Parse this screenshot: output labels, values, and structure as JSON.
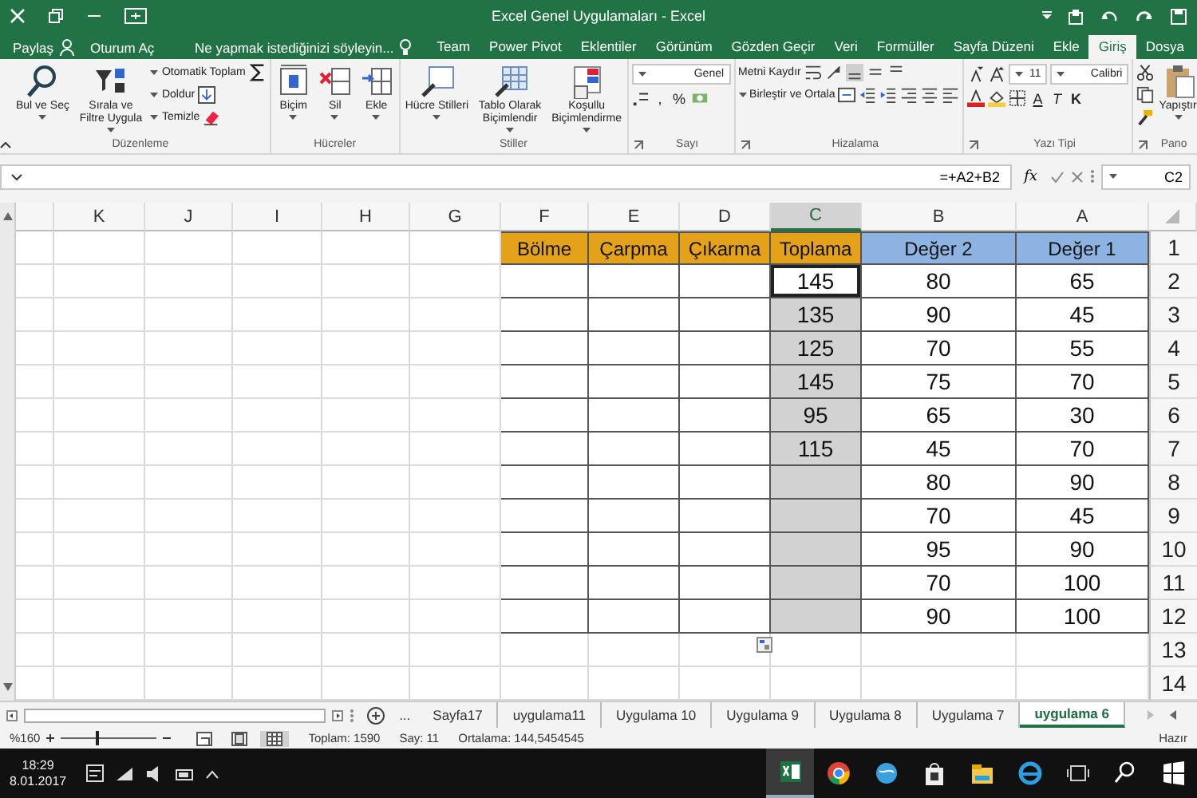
{
  "window": {
    "title": "Excel Genel Uygulamaları - Excel"
  },
  "account": {
    "share": "Paylaş",
    "sign_in": "Oturum Aç"
  },
  "tell_me": {
    "placeholder": "Ne yapmak istediğinizi söyleyin..."
  },
  "ribbon_tabs": [
    {
      "label": "Team",
      "selected": false
    },
    {
      "label": "Power Pivot",
      "selected": false
    },
    {
      "label": "Eklentiler",
      "selected": false
    },
    {
      "label": "Görünüm",
      "selected": false
    },
    {
      "label": "Gözden Geçir",
      "selected": false
    },
    {
      "label": "Veri",
      "selected": false
    },
    {
      "label": "Formüller",
      "selected": false
    },
    {
      "label": "Sayfa Düzeni",
      "selected": false
    },
    {
      "label": "Ekle",
      "selected": false
    },
    {
      "label": "Giriş",
      "selected": true
    },
    {
      "label": "Dosya",
      "selected": false
    }
  ],
  "ribbon_groups": [
    {
      "label": "Düzenleme",
      "launcher": false,
      "items": [
        {
          "kind": "large",
          "label": "Bul ve Seç",
          "menu": true
        },
        {
          "kind": "large",
          "label": "Sırala ve Filtre Uygula",
          "menu": true
        },
        {
          "kind": "stack",
          "lines": [
            {
              "items": [
                {
                  "kind": "small",
                  "label": "Otomatik Toplam",
                  "menu": true
                }
              ]
            },
            {
              "items": [
                {
                  "kind": "small",
                  "label": "Doldur",
                  "menu": true
                }
              ]
            },
            {
              "items": [
                {
                  "kind": "small",
                  "label": "Temizle",
                  "menu": true
                }
              ]
            }
          ]
        }
      ]
    },
    {
      "label": "Hücreler",
      "launcher": false,
      "items": [
        {
          "kind": "large",
          "label": "Biçim",
          "menu": true
        },
        {
          "kind": "large",
          "label": "Sil",
          "menu": true
        },
        {
          "kind": "large",
          "label": "Ekle",
          "menu": true
        }
      ]
    },
    {
      "label": "Stiller",
      "launcher": false,
      "items": [
        {
          "kind": "large",
          "label": "Hücre Stilleri",
          "menu": true
        },
        {
          "kind": "large",
          "label": "Tablo Olarak Biçimlendir",
          "menu": true
        },
        {
          "kind": "large",
          "label": "Koşullu Biçimlendirme",
          "menu": true
        }
      ]
    },
    {
      "label": "Sayı",
      "launcher": true,
      "items": [
        {
          "kind": "stack",
          "lines": [
            {
              "items": [
                {
                  "kind": "combo",
                  "value": "Genel"
                }
              ]
            },
            {
              "items": [
                {
                  "kind": "icon"
                },
                {
                  "kind": "glyph",
                  "text": ","
                },
                {
                  "kind": "glyph",
                  "text": "%"
                },
                {
                  "kind": "icon"
                }
              ]
            }
          ]
        }
      ]
    },
    {
      "label": "Hizalama",
      "launcher": true,
      "items": [
        {
          "kind": "stack",
          "lines": [
            {
              "items": [
                {
                  "kind": "small",
                  "label": "Metni Kaydır",
                  "menu": false
                },
                {
                  "kind": "icon"
                },
                {
                  "kind": "icon"
                },
                {
                  "kind": "icon"
                },
                {
                  "kind": "icon"
                }
              ]
            },
            {
              "items": [
                {
                  "kind": "small",
                  "label": "Birleştir ve Ortala",
                  "menu": true
                },
                {
                  "kind": "icon"
                },
                {
                  "kind": "icon"
                },
                {
                  "kind": "icon"
                },
                {
                  "kind": "icon"
                },
                {
                  "kind": "icon"
                }
              ]
            }
          ]
        }
      ]
    },
    {
      "label": "Yazı Tipi",
      "launcher": true,
      "items": [
        {
          "kind": "stack",
          "lines": [
            {
              "items": [
                {
                  "kind": "icon"
                },
                {
                  "kind": "icon"
                },
                {
                  "kind": "combo",
                  "value": "11"
                },
                {
                  "kind": "combo",
                  "value": "Calibri"
                }
              ]
            },
            {
              "items": [
                {
                  "kind": "icon"
                },
                {
                  "kind": "icon"
                },
                {
                  "kind": "icon"
                },
                {
                  "kind": "glyph",
                  "text": "A"
                },
                {
                  "kind": "glyph",
                  "text": "T"
                },
                {
                  "kind": "glyph",
                  "text": "K"
                }
              ]
            }
          ]
        }
      ]
    },
    {
      "label": "Pano",
      "launcher": true,
      "items": [
        {
          "kind": "stack",
          "lines": [
            {
              "items": [
                {
                  "kind": "icon"
                }
              ]
            },
            {
              "items": [
                {
                  "kind": "icon"
                }
              ]
            },
            {
              "items": [
                {
                  "kind": "icon"
                }
              ]
            }
          ]
        },
        {
          "kind": "large",
          "label": "Yapıştır",
          "menu": true
        }
      ]
    }
  ],
  "formula_bar": {
    "formula": "=+A2+B2",
    "function_label": "fx",
    "name_box": "C2"
  },
  "sheet": {
    "columns": [
      {
        "label": "K",
        "selected": false
      },
      {
        "label": "J",
        "selected": false
      },
      {
        "label": "I",
        "selected": false
      },
      {
        "label": "H",
        "selected": false
      },
      {
        "label": "G",
        "selected": false
      },
      {
        "label": "F",
        "selected": false
      },
      {
        "label": "E",
        "selected": false
      },
      {
        "label": "D",
        "selected": false
      },
      {
        "label": "C",
        "selected": true
      },
      {
        "label": "B",
        "selected": false
      },
      {
        "label": "A",
        "selected": false
      }
    ],
    "rows": [
      {
        "cells": [
          {
            "text": "Bölme",
            "color": "#e3a21a"
          },
          {
            "text": "Çarpma",
            "color": "#e3a21a"
          },
          {
            "text": "Çıkarma",
            "color": "#e3a21a"
          },
          {
            "text": "Toplama",
            "color": "#e3a21a"
          },
          {
            "text": "Değer 2",
            "color": "#8db3e2"
          },
          {
            "text": "Değer 1",
            "color": "#8db3e2"
          }
        ],
        "number": "1"
      },
      {
        "cells": [
          {
            "selected": false,
            "active": false
          },
          {
            "selected": false,
            "active": false
          },
          {
            "selected": false,
            "active": false
          },
          {
            "text": "145",
            "selected": false,
            "active": true
          },
          {
            "text": "80",
            "selected": false,
            "active": false
          },
          {
            "text": "65",
            "selected": false,
            "active": false
          }
        ],
        "number": "2"
      },
      {
        "cells": [
          {
            "selected": false,
            "active": false
          },
          {
            "selected": false,
            "active": false
          },
          {
            "selected": false,
            "active": false
          },
          {
            "text": "135",
            "selected": true,
            "active": false
          },
          {
            "text": "90",
            "selected": false,
            "active": false
          },
          {
            "text": "45",
            "selected": false,
            "active": false
          }
        ],
        "number": "3"
      },
      {
        "cells": [
          {
            "selected": false,
            "active": false
          },
          {
            "selected": false,
            "active": false
          },
          {
            "selected": false,
            "active": false
          },
          {
            "text": "125",
            "selected": true,
            "active": false
          },
          {
            "text": "70",
            "selected": false,
            "active": false
          },
          {
            "text": "55",
            "selected": false,
            "active": false
          }
        ],
        "number": "4"
      },
      {
        "cells": [
          {
            "selected": false,
            "active": false
          },
          {
            "selected": false,
            "active": false
          },
          {
            "selected": false,
            "active": false
          },
          {
            "text": "145",
            "selected": true,
            "active": false
          },
          {
            "text": "75",
            "selected": false,
            "active": false
          },
          {
            "text": "70",
            "selected": false,
            "active": false
          }
        ],
        "number": "5"
      },
      {
        "cells": [
          {
            "selected": false,
            "active": false
          },
          {
            "selected": false,
            "active": false
          },
          {
            "selected": false,
            "active": false
          },
          {
            "text": "95",
            "selected": true,
            "active": false
          },
          {
            "text": "65",
            "selected": false,
            "active": false
          },
          {
            "text": "30",
            "selected": false,
            "active": false
          }
        ],
        "number": "6"
      },
      {
        "cells": [
          {
            "selected": false,
            "active": false
          },
          {
            "selected": false,
            "active": false
          },
          {
            "selected": false,
            "active": false
          },
          {
            "text": "115",
            "selected": true,
            "active": false
          },
          {
            "text": "45",
            "selected": false,
            "active": false
          },
          {
            "text": "70",
            "selected": false,
            "active": false
          }
        ],
        "number": "7"
      },
      {
        "cells": [
          {
            "selected": false,
            "active": false
          },
          {
            "selected": false,
            "active": false
          },
          {
            "selected": false,
            "active": false
          },
          {
            "selected": true,
            "active": false
          },
          {
            "text": "80",
            "selected": false,
            "active": false
          },
          {
            "text": "90",
            "selected": false,
            "active": false
          }
        ],
        "number": "8"
      },
      {
        "cells": [
          {
            "selected": false,
            "active": false
          },
          {
            "selected": false,
            "active": false
          },
          {
            "selected": false,
            "active": false
          },
          {
            "selected": true,
            "active": false
          },
          {
            "text": "70",
            "selected": false,
            "active": false
          },
          {
            "text": "45",
            "selected": false,
            "active": false
          }
        ],
        "number": "9"
      },
      {
        "cells": [
          {
            "selected": false,
            "active": false
          },
          {
            "selected": false,
            "active": false
          },
          {
            "selected": false,
            "active": false
          },
          {
            "selected": true,
            "active": false
          },
          {
            "text": "95",
            "selected": false,
            "active": false
          },
          {
            "text": "90",
            "selected": false,
            "active": false
          }
        ],
        "number": "10"
      },
      {
        "cells": [
          {
            "selected": false,
            "active": false
          },
          {
            "selected": false,
            "active": false
          },
          {
            "selected": false,
            "active": false
          },
          {
            "selected": true,
            "active": false
          },
          {
            "text": "70",
            "selected": false,
            "active": false
          },
          {
            "text": "100",
            "selected": false,
            "active": false
          }
        ],
        "number": "11"
      },
      {
        "cells": [
          {
            "selected": false,
            "active": false
          },
          {
            "selected": false,
            "active": false
          },
          {
            "selected": false,
            "active": false
          },
          {
            "selected": true,
            "active": false
          },
          {
            "text": "90",
            "selected": false,
            "active": false
          },
          {
            "text": "100",
            "selected": false,
            "active": false
          }
        ],
        "number": "12"
      },
      {
        "number": "13"
      },
      {
        "number": "14"
      }
    ]
  },
  "sheet_tabs_more": "...",
  "sheet_tabs": [
    {
      "label": "Sayfa17",
      "selected": false
    },
    {
      "label": "uygulama11",
      "selected": false
    },
    {
      "label": "Uygulama 10",
      "selected": false
    },
    {
      "label": "Uygulama 9",
      "selected": false
    },
    {
      "label": "Uygulama 8",
      "selected": false
    },
    {
      "label": "Uygulama 7",
      "selected": false
    },
    {
      "label": "uygulama 6",
      "selected": true
    }
  ],
  "status_bar": {
    "zoom": "%160",
    "views": [
      {
        "selected": false
      },
      {
        "selected": false
      },
      {
        "selected": true
      }
    ],
    "stats": [
      "Toplam: 1590",
      "Say: 11",
      "Ortalama: 144,5454545"
    ],
    "mode": "Hazır"
  },
  "taskbar": {
    "time": "18:29",
    "date": "8.01.2017",
    "apps": [
      {
        "selected": true
      },
      {
        "selected": false
      },
      {
        "selected": false
      },
      {
        "selected": false
      },
      {
        "selected": false
      },
      {
        "selected": false
      },
      {
        "selected": false
      },
      {
        "selected": false
      },
      {
        "selected": false
      }
    ]
  }
}
